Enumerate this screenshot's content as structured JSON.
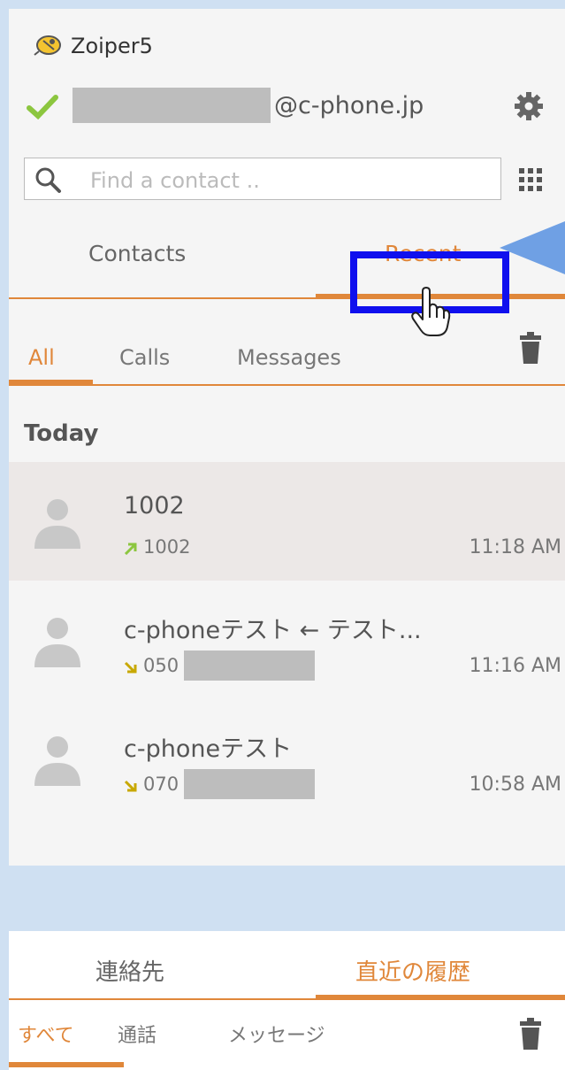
{
  "app": {
    "title": "Zoiper5"
  },
  "account": {
    "domain": "@c-phone.jp"
  },
  "search": {
    "placeholder": "Find a contact .."
  },
  "main_tabs": {
    "contacts": "Contacts",
    "recent": "Recent"
  },
  "sub_tabs": {
    "all": "All",
    "calls": "Calls",
    "messages": "Messages"
  },
  "section": {
    "today": "Today"
  },
  "recents": [
    {
      "name": "1002",
      "direction": "outgoing",
      "number": "1002",
      "time": "11:18 AM",
      "selected": true
    },
    {
      "name": "c-phoneテスト ← テスト...",
      "direction": "incoming",
      "number": "050",
      "time": "11:16 AM",
      "selected": false
    },
    {
      "name": "c-phoneテスト",
      "direction": "incoming",
      "number": "070",
      "time": "10:58 AM",
      "selected": false
    }
  ],
  "jp": {
    "main_tabs": {
      "contacts": "連絡先",
      "recent": "直近の履歴"
    },
    "sub_tabs": {
      "all": "すべて",
      "calls": "通話",
      "messages": "メッセージ"
    }
  },
  "colors": {
    "accent": "#e0873a",
    "highlight": "#1010ee",
    "callout": "#6fa0e4",
    "check": "#8cc63f",
    "background": "#cfe0f2"
  },
  "icons": [
    "zoiper-logo-icon",
    "check-icon",
    "gear-icon",
    "search-icon",
    "dialpad-icon",
    "trash-icon",
    "avatar-icon",
    "outgoing-arrow-icon",
    "incoming-arrow-icon",
    "hand-cursor-icon"
  ]
}
